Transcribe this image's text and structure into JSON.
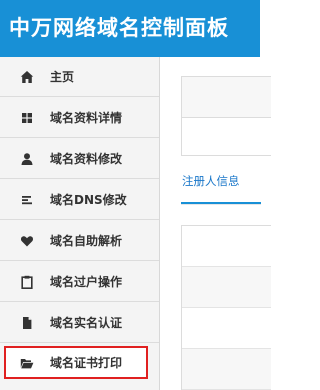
{
  "header": {
    "title": "中万网络域名控制面板"
  },
  "sidebar": {
    "items": [
      {
        "label": "主页",
        "icon": "home-icon"
      },
      {
        "label": "域名资料详情",
        "icon": "grid-icon"
      },
      {
        "label": "域名资料修改",
        "icon": "user-icon"
      },
      {
        "label": "域名DNS修改",
        "icon": "list-icon"
      },
      {
        "label": "域名自助解析",
        "icon": "heart-icon"
      },
      {
        "label": "域名过户操作",
        "icon": "clipboard-icon"
      },
      {
        "label": "域名实名认证",
        "icon": "document-icon"
      },
      {
        "label": "域名证书打印",
        "icon": "folder-open-icon"
      }
    ]
  },
  "main": {
    "tabs": [
      {
        "label": "注册人信息"
      }
    ]
  },
  "colors": {
    "header_bg": "#1890d6",
    "tab_active": "#1a77c9",
    "highlight_border": "#e02020"
  }
}
